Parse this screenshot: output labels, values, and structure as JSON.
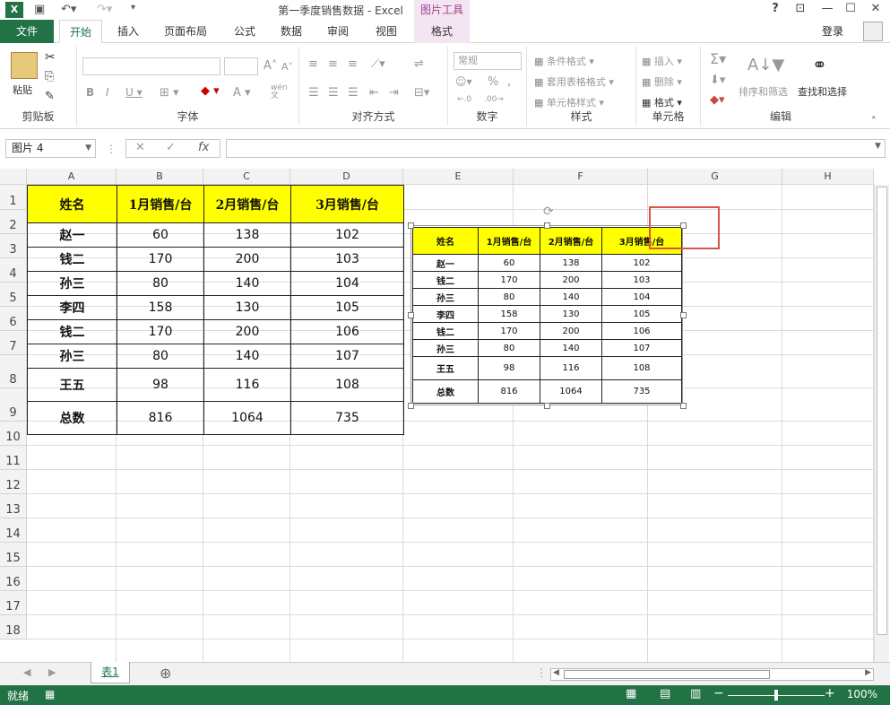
{
  "titlebar": {
    "app_icon": "X",
    "title": "第一季度销售数据 - Excel",
    "picture_tools": "图片工具",
    "help": "?",
    "restore_icon": "restore-ribbon-icon"
  },
  "tabs": {
    "file": "文件",
    "home": "开始",
    "insert": "插入",
    "layout": "页面布局",
    "formula": "公式",
    "data": "数据",
    "review": "审阅",
    "view": "视图",
    "format": "格式",
    "login": "登录"
  },
  "ribbon": {
    "clipboard": {
      "paste": "粘贴",
      "label": "剪贴板"
    },
    "font": {
      "label": "字体",
      "wen": "wén\n文"
    },
    "align": {
      "label": "对齐方式"
    },
    "number": {
      "format": "常规",
      "percent": "%",
      "comma": ",",
      "label": "数字"
    },
    "styles": {
      "cond": "条件格式",
      "table": "套用表格格式",
      "cell": "单元格样式",
      "label": "样式"
    },
    "cells": {
      "insert": "插入",
      "delete": "删除",
      "format": "格式",
      "label": "单元格"
    },
    "edit": {
      "sort": "排序和筛选",
      "find": "查找和选择",
      "label": "编辑"
    }
  },
  "formula_bar": {
    "name_box": "图片 4",
    "fx": "fx",
    "value": ""
  },
  "columns": [
    "A",
    "B",
    "C",
    "D",
    "E",
    "F",
    "G",
    "H"
  ],
  "rows": [
    "1",
    "2",
    "3",
    "4",
    "5",
    "6",
    "7",
    "8",
    "9",
    "10",
    "11",
    "12",
    "13",
    "14",
    "15",
    "16",
    "17",
    "18"
  ],
  "table": {
    "header": [
      "姓名",
      "1月销售/台",
      "2月销售/台",
      "3月销售/台"
    ],
    "rows": [
      [
        "赵一",
        "60",
        "138",
        "102"
      ],
      [
        "钱二",
        "170",
        "200",
        "103"
      ],
      [
        "孙三",
        "80",
        "140",
        "104"
      ],
      [
        "李四",
        "158",
        "130",
        "105"
      ],
      [
        "钱二",
        "170",
        "200",
        "106"
      ],
      [
        "孙三",
        "80",
        "140",
        "107"
      ],
      [
        "王五",
        "98",
        "116",
        "108"
      ],
      [
        "总数",
        "816",
        "1064",
        "735"
      ]
    ]
  },
  "picture_table": {
    "header": [
      "姓名",
      "1月销售/台",
      "2月销售/台",
      "3月销售/台"
    ],
    "rows": [
      [
        "赵一",
        "60",
        "138",
        "102"
      ],
      [
        "钱二",
        "170",
        "200",
        "103"
      ],
      [
        "孙三",
        "80",
        "140",
        "104"
      ],
      [
        "李四",
        "158",
        "130",
        "105"
      ],
      [
        "钱二",
        "170",
        "200",
        "106"
      ],
      [
        "孙三",
        "80",
        "140",
        "107"
      ],
      [
        "王五",
        "98",
        "116",
        "108"
      ],
      [
        "总数",
        "816",
        "1064",
        "735"
      ]
    ]
  },
  "sheet": {
    "tab": "表1",
    "add": "⊕"
  },
  "status": {
    "ready": "就绪",
    "zoom": "100%"
  },
  "colors": {
    "excel_green": "#217346",
    "header_yellow": "#ffff00",
    "highlight_red": "#d9534f",
    "picture_tools": "#f3e6f2"
  }
}
